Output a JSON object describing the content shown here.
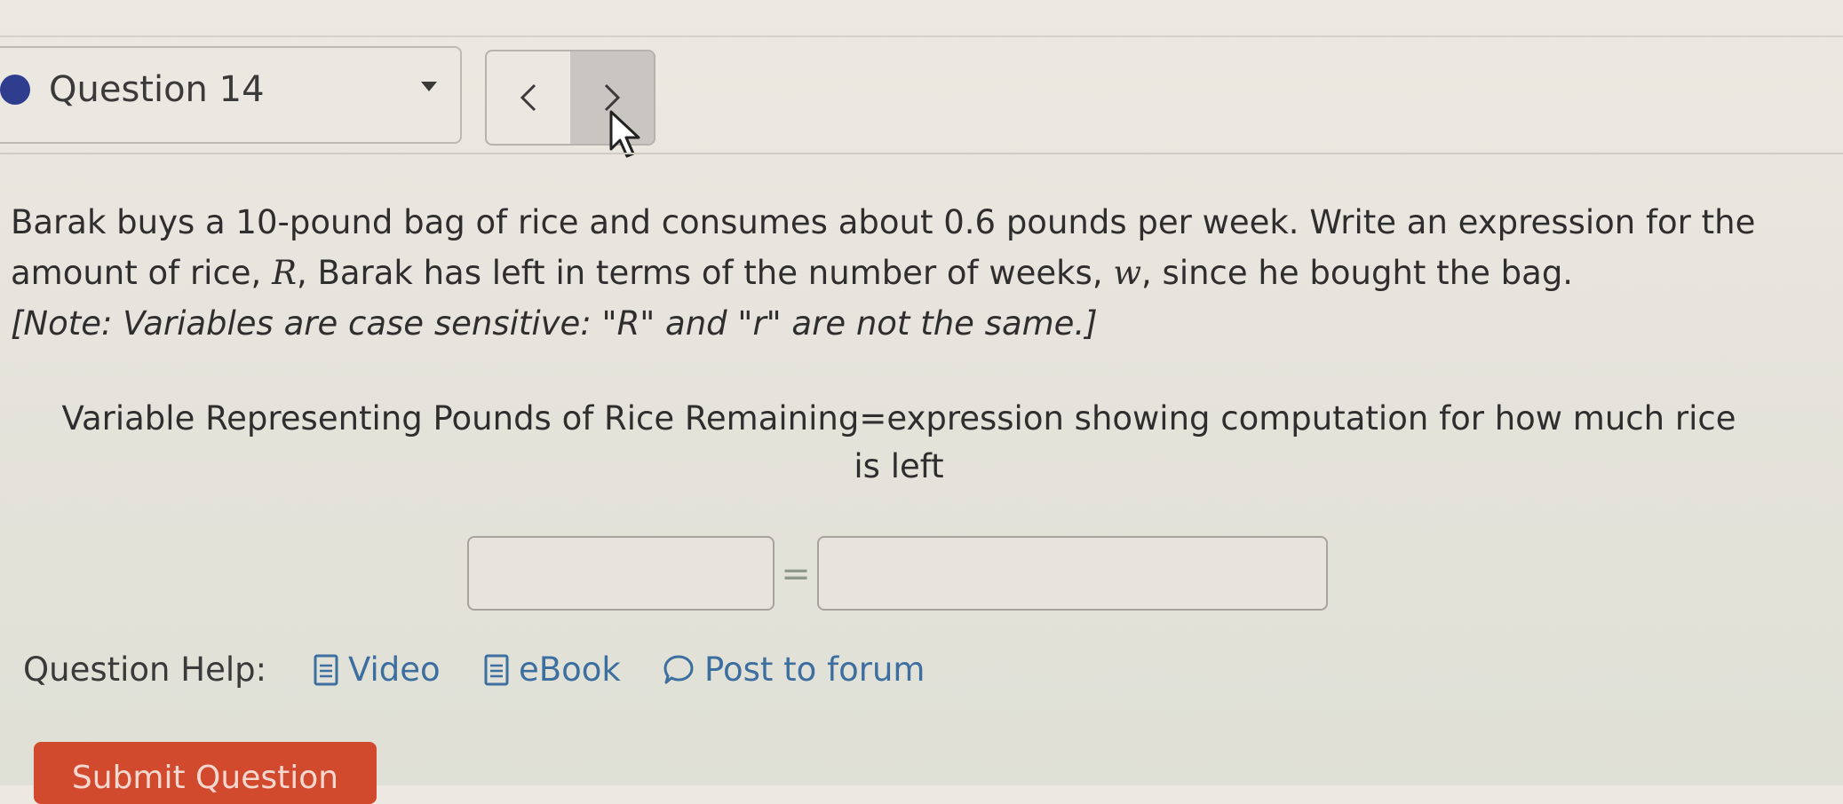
{
  "question": {
    "label": "Question 14"
  },
  "nav": {
    "prev_symbol": "<",
    "next_symbol": ">"
  },
  "problem": {
    "text_a": "Barak buys a 10-pound bag of rice and consumes about 0.6 pounds per week. Write an expression for the amount of rice, ",
    "var_R": "R",
    "text_b": ", Barak has left in terms of the number of weeks, ",
    "var_w": "w",
    "text_c": ", since he bought the bag.",
    "note": "[Note: Variables are case sensitive: \"R\" and \"r\" are not the same.]"
  },
  "variable_description": {
    "line1": "Variable Representing Pounds of Rice Remaining=expression showing computation for how much rice",
    "line2": "is left"
  },
  "answer": {
    "equals": "=",
    "left_value": "",
    "right_value": ""
  },
  "help": {
    "label": "Question Help:",
    "video": "Video",
    "ebook": "eBook",
    "forum": "Post to forum"
  },
  "submit": {
    "label": "Submit Question"
  },
  "colors": {
    "accent_dot": "#2f3d8f",
    "link": "#3d6ea0",
    "submit_bg": "#d24a2e"
  }
}
